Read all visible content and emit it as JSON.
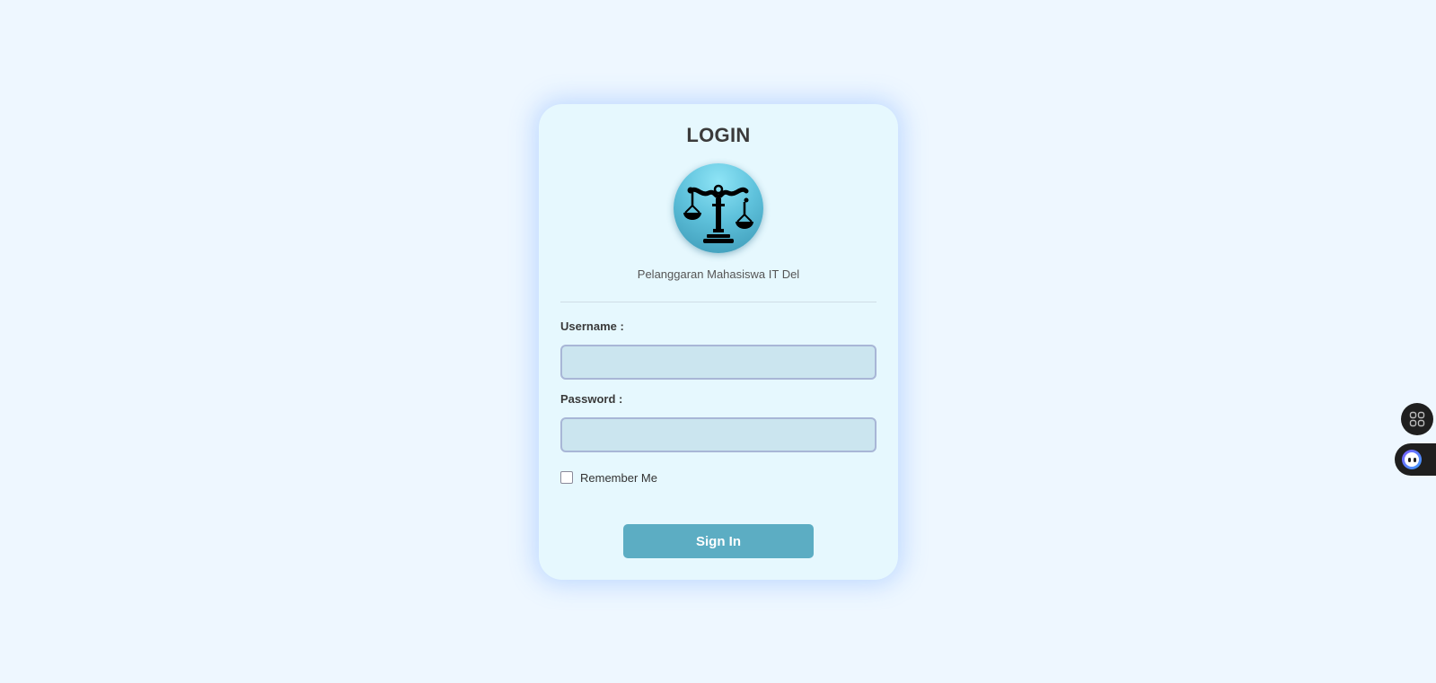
{
  "login_card": {
    "title": "LOGIN",
    "logo_icon": "scales-of-justice-icon",
    "subtitle": "Pelanggaran Mahasiswa IT Del",
    "username_label": "Username :",
    "username_value": "",
    "password_label": "Password :",
    "password_value": "",
    "remember_label": "Remember Me",
    "remember_checked": false,
    "signin_label": "Sign In"
  },
  "floating_widgets": {
    "apps_icon": "grid-apps-icon",
    "assistant_icon": "assistant-bot-icon"
  },
  "colors": {
    "page_background": "#eef7ff",
    "card_background": "#e6f8fe",
    "input_background": "#cbe5ef",
    "button_background": "#5cadc3",
    "logo_accent": "#5fc2dc"
  }
}
